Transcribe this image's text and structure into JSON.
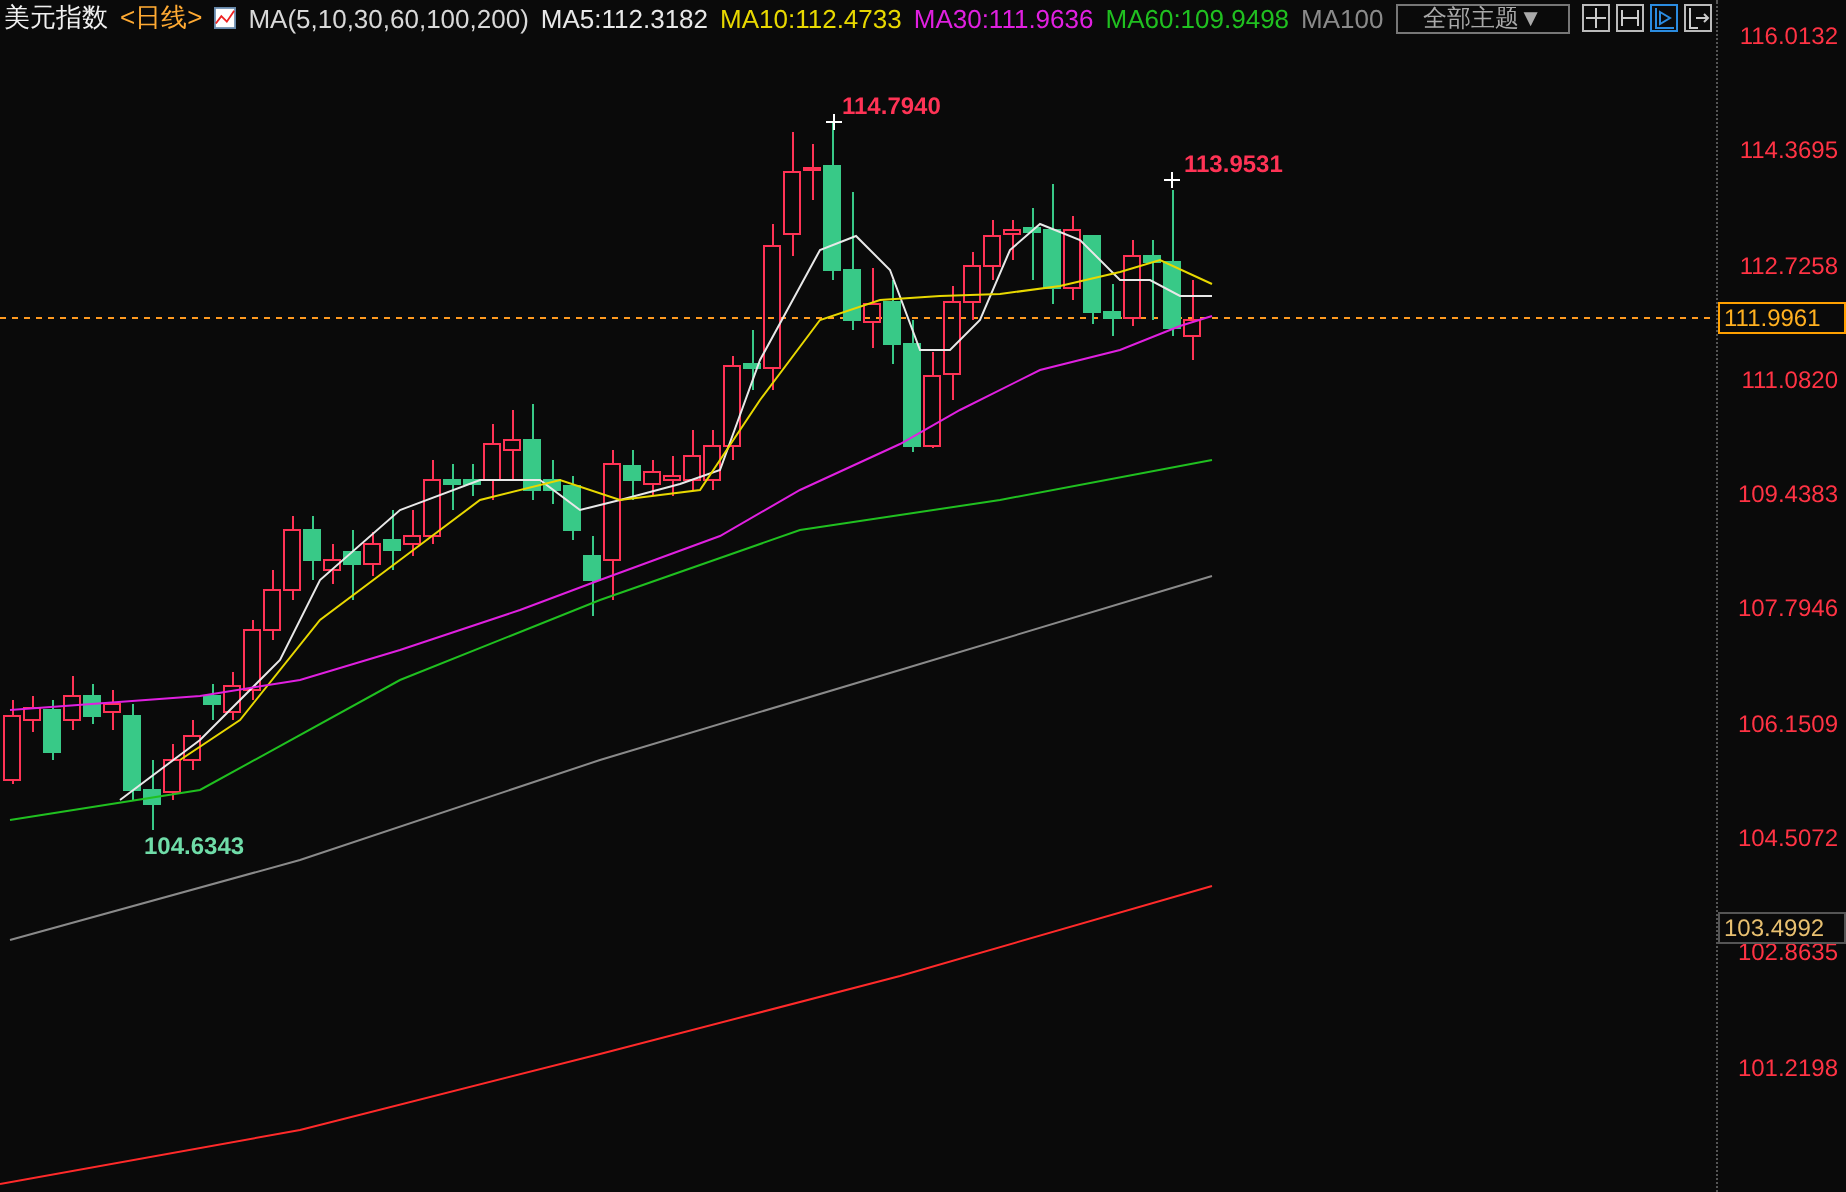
{
  "header": {
    "symbol": "美元指数",
    "period": "<日线>",
    "indicator": "MA(5,10,30,60,100,200)",
    "ma_readings": [
      {
        "text": "MA5:112.3182",
        "color": "#e8e8e8"
      },
      {
        "text": "MA10:112.4733",
        "color": "#e8d800"
      },
      {
        "text": "MA30:111.9636",
        "color": "#e020e0"
      },
      {
        "text": "MA60:109.9498",
        "color": "#20c020"
      },
      {
        "text": "MA100",
        "color": "#8a8a8a"
      }
    ],
    "theme_button": "全部主题▼",
    "tools": [
      {
        "kind": "crosshair",
        "selected": false
      },
      {
        "kind": "fit",
        "selected": false
      },
      {
        "kind": "play",
        "selected": true
      },
      {
        "kind": "exit",
        "selected": false
      }
    ]
  },
  "axis": {
    "ticks": [
      "116.0132",
      "114.3695",
      "112.7258",
      "111.0820",
      "109.4383",
      "107.7946",
      "106.1509",
      "104.5072",
      "102.8635",
      "101.2198"
    ]
  },
  "price_tags": [
    {
      "text": "111.9961",
      "kind": "current"
    },
    {
      "text": "103.4992",
      "kind": "reference"
    }
  ],
  "annotations": [
    {
      "text": "114.7940",
      "kind": "high"
    },
    {
      "text": "113.9531",
      "kind": "high"
    },
    {
      "text": "104.6343",
      "kind": "low"
    }
  ]
}
